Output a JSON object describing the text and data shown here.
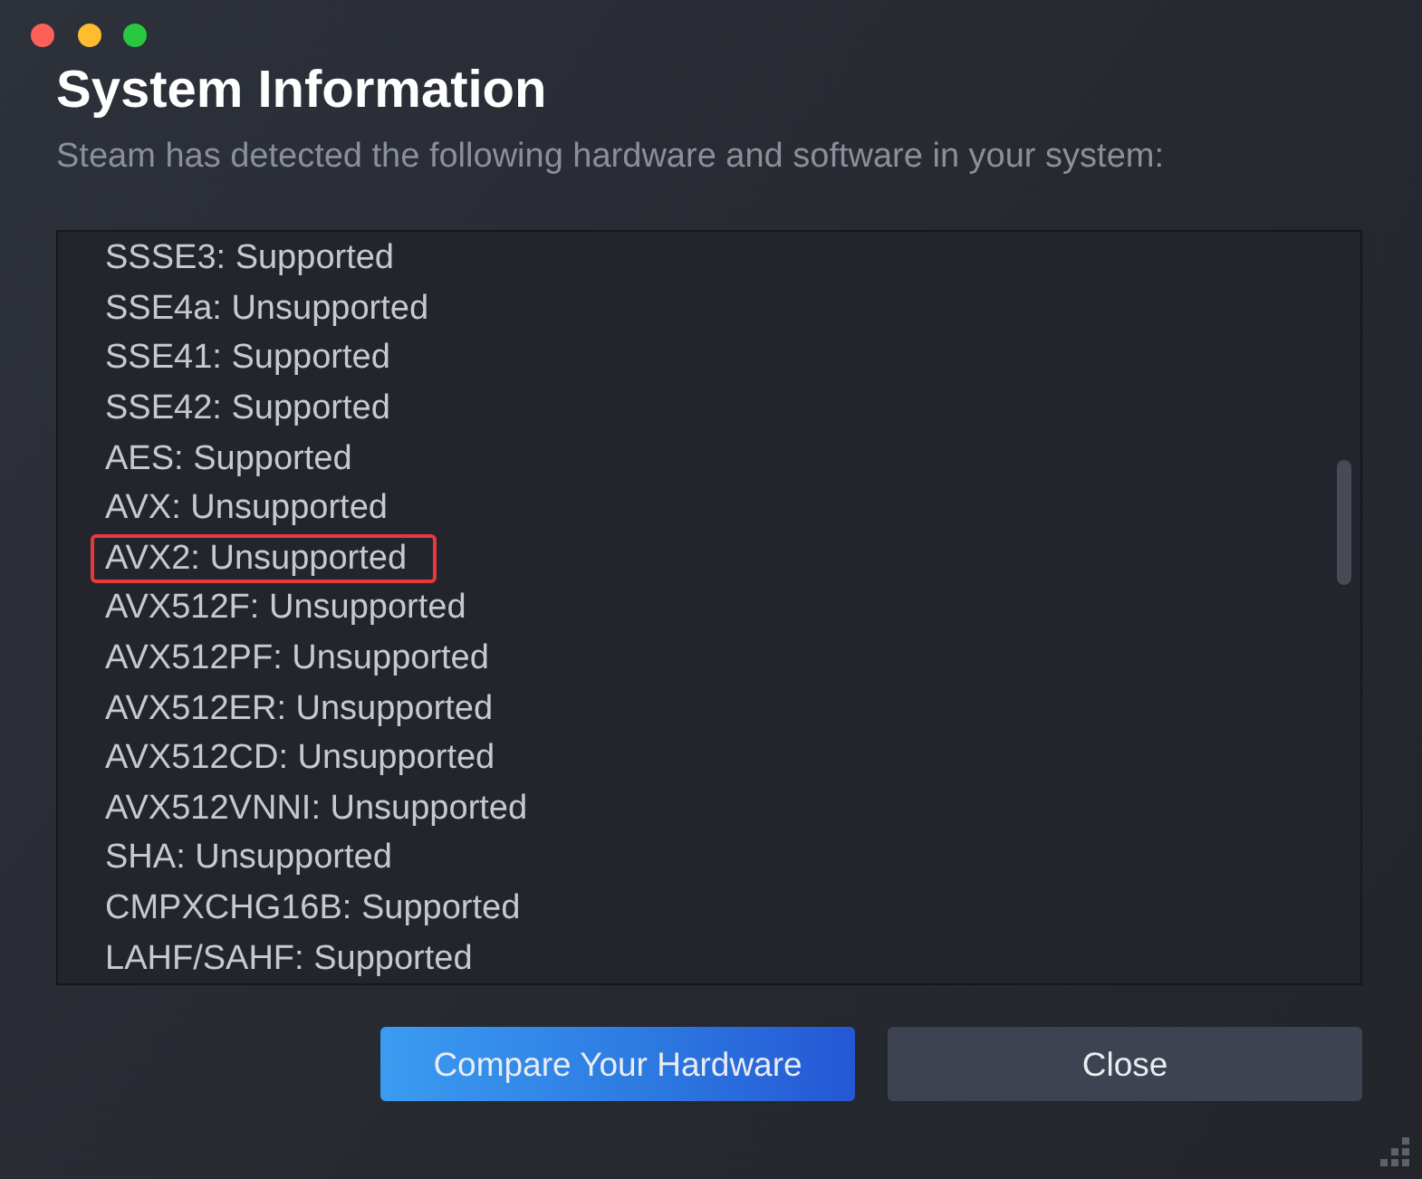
{
  "window": {
    "title": "System Information",
    "subtitle": "Steam has detected the following hardware and software in your system:"
  },
  "info_list": {
    "items": [
      {
        "text": "SSSE3: Supported",
        "highlighted": false
      },
      {
        "text": "SSE4a: Unsupported",
        "highlighted": false
      },
      {
        "text": "SSE41: Supported",
        "highlighted": false
      },
      {
        "text": "SSE42: Supported",
        "highlighted": false
      },
      {
        "text": "AES: Supported",
        "highlighted": false
      },
      {
        "text": "AVX: Unsupported",
        "highlighted": false
      },
      {
        "text": "AVX2: Unsupported",
        "highlighted": true
      },
      {
        "text": "AVX512F: Unsupported",
        "highlighted": false
      },
      {
        "text": "AVX512PF: Unsupported",
        "highlighted": false
      },
      {
        "text": "AVX512ER: Unsupported",
        "highlighted": false
      },
      {
        "text": "AVX512CD: Unsupported",
        "highlighted": false
      },
      {
        "text": "AVX512VNNI: Unsupported",
        "highlighted": false
      },
      {
        "text": "SHA: Unsupported",
        "highlighted": false
      },
      {
        "text": "CMPXCHG16B: Supported",
        "highlighted": false
      },
      {
        "text": "LAHF/SAHF: Supported",
        "highlighted": false
      }
    ]
  },
  "buttons": [
    {
      "label": "Compare Your Hardware",
      "kind": "primary"
    },
    {
      "label": "Close",
      "kind": "secondary"
    }
  ]
}
